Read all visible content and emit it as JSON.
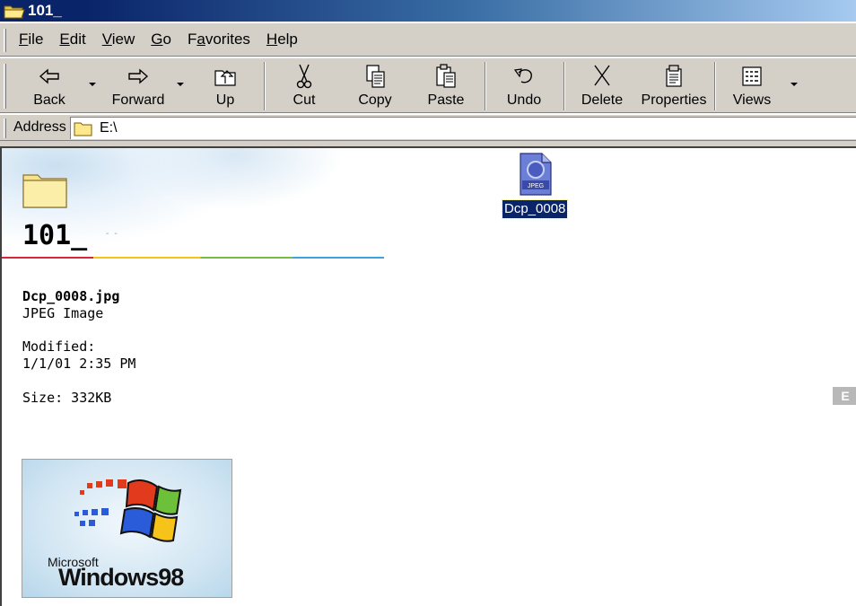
{
  "window": {
    "title": "101_"
  },
  "menu": {
    "items": [
      {
        "id": "file",
        "label": "File",
        "accel": "F"
      },
      {
        "id": "edit",
        "label": "Edit",
        "accel": "E"
      },
      {
        "id": "view",
        "label": "View",
        "accel": "V"
      },
      {
        "id": "go",
        "label": "Go",
        "accel": "G"
      },
      {
        "id": "favorites",
        "label": "Favorites",
        "accel": "a"
      },
      {
        "id": "help",
        "label": "Help",
        "accel": "H"
      }
    ]
  },
  "toolbar": {
    "back": "Back",
    "forward": "Forward",
    "up": "Up",
    "cut": "Cut",
    "copy": "Copy",
    "paste": "Paste",
    "undo": "Undo",
    "delete": "Delete",
    "properties": "Properties",
    "views": "Views"
  },
  "address": {
    "label": "Address",
    "value": "E:\\"
  },
  "content": {
    "folder_title": "101_",
    "file_name": "Dcp_0008.jpg",
    "file_type": "JPEG Image",
    "modified_label": "Modified:",
    "modified_value": "1/1/01 2:35 PM",
    "size": "Size: 332KB",
    "preview_brand_small": "Microsoft",
    "preview_brand_large": "Windows98",
    "icon_label": "Dcp_0008",
    "icon_badge": "JPEG",
    "drive_badge": "E"
  },
  "colors": {
    "titlebar_start": "#0a246a",
    "titlebar_end": "#a6caf0",
    "chrome": "#d4d0c8",
    "selection": "#0a246a",
    "rainbow": [
      "#d7283b",
      "#f5c21a",
      "#76be43",
      "#3ea4e0"
    ]
  }
}
